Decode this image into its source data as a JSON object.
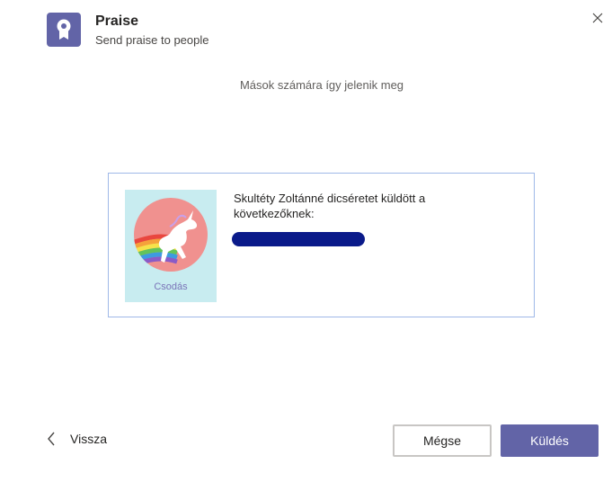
{
  "header": {
    "title": "Praise",
    "subtitle": "Send praise to people",
    "icon": "ribbon-badge-icon",
    "close_icon": "close-icon"
  },
  "preview": {
    "caption": "Mások számára így jelenik meg",
    "badge_label": "Csodás",
    "badge_icon": "unicorn-rainbow-icon",
    "message": "Skultéty Zoltánné dicséretet küldött a következőknek:"
  },
  "footer": {
    "back_label": "Vissza",
    "cancel_label": "Mégse",
    "send_label": "Küldés"
  },
  "colors": {
    "accent": "#6264a7",
    "badge_background": "#c8ecf0",
    "badge_circle": "#f0918f"
  }
}
